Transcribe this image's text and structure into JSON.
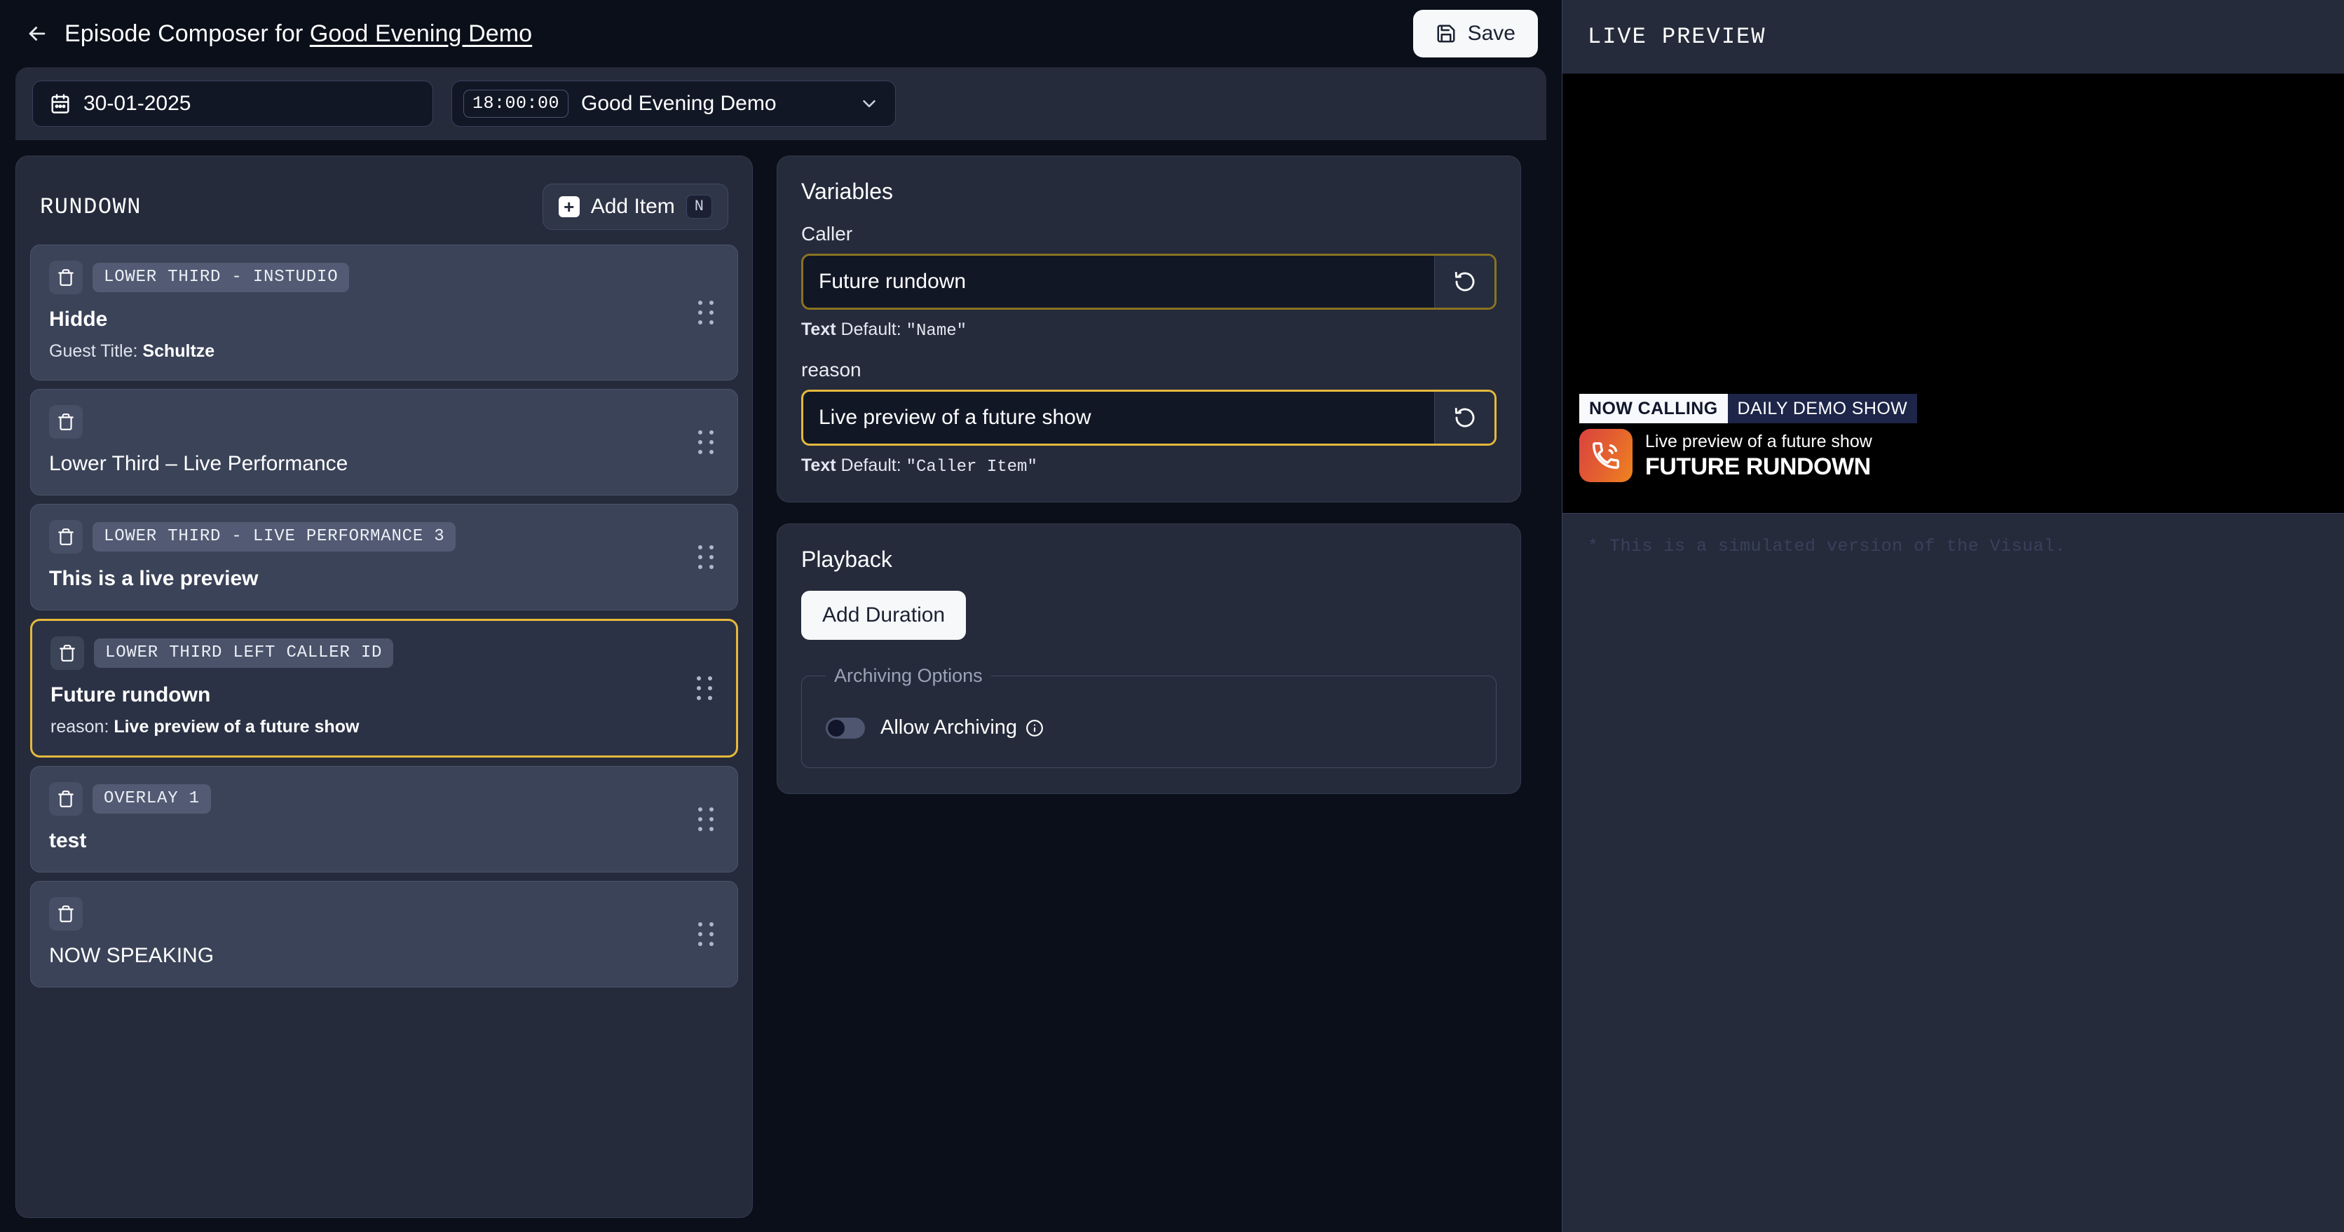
{
  "header": {
    "back_icon": "arrow-left-icon",
    "title_prefix": "Episode Composer for ",
    "show_name": "Good Evening Demo",
    "save_label": "Save",
    "save_icon": "floppy-disk-icon"
  },
  "strip": {
    "date_icon": "calendar-icon",
    "date_value": "30-01-2025",
    "episode_time": "18:00:00",
    "episode_name": "Good Evening Demo",
    "chevron_icon": "chevron-down-icon"
  },
  "rundown": {
    "title": "RUNDOWN",
    "add_item_label": "Add Item",
    "add_item_icon": "plus-square-icon",
    "add_item_shortcut": "N",
    "items": [
      {
        "badge": "LOWER THIRD - INSTUDIO",
        "title": "Hidde",
        "title_bold": true,
        "sub_label": "Guest Title: ",
        "sub_value": "Schultze",
        "selected": false,
        "delete_icon": "trash-icon",
        "drag_icon": "drag-handle-icon"
      },
      {
        "badge": "",
        "title": "Lower Third – Live Performance",
        "title_bold": false,
        "sub_label": "",
        "sub_value": "",
        "selected": false,
        "delete_icon": "trash-icon",
        "drag_icon": "drag-handle-icon"
      },
      {
        "badge": "LOWER THIRD - LIVE PERFORMANCE 3",
        "title": "This is a live preview",
        "title_bold": true,
        "sub_label": "",
        "sub_value": "",
        "selected": false,
        "delete_icon": "trash-icon",
        "drag_icon": "drag-handle-icon"
      },
      {
        "badge": "LOWER THIRD LEFT CALLER ID",
        "title": "Future rundown",
        "title_bold": true,
        "sub_label": "reason: ",
        "sub_value": "Live preview of a future show",
        "selected": true,
        "delete_icon": "trash-icon",
        "drag_icon": "drag-handle-icon"
      },
      {
        "badge": "OVERLAY 1",
        "title": "test",
        "title_bold": true,
        "sub_label": "",
        "sub_value": "",
        "selected": false,
        "delete_icon": "trash-icon",
        "drag_icon": "drag-handle-icon"
      },
      {
        "badge": "",
        "title": "NOW SPEAKING",
        "title_bold": false,
        "sub_label": "",
        "sub_value": "",
        "selected": false,
        "delete_icon": "trash-icon",
        "drag_icon": "drag-handle-icon"
      }
    ]
  },
  "variables": {
    "title": "Variables",
    "reset_icon": "reset-circular-arrow-icon",
    "fields": [
      {
        "label": "Caller",
        "value": "Future rundown",
        "hint_type": "Text",
        "hint_text": " Default: ",
        "hint_default": "\"Name\"",
        "focused": false
      },
      {
        "label": "reason",
        "value": "Live preview of a future show",
        "hint_type": "Text",
        "hint_text": " Default: ",
        "hint_default": "\"Caller Item\"",
        "focused": true
      }
    ]
  },
  "playback": {
    "title": "Playback",
    "add_duration_label": "Add Duration",
    "archiving_legend": "Archiving Options",
    "allow_archiving_label": "Allow Archiving",
    "allow_archiving_on": false,
    "info_icon": "info-circle-icon"
  },
  "preview": {
    "title": "LIVE PREVIEW",
    "note": "* This is a simulated version of the Visual.",
    "caller_id": {
      "now_calling": "NOW CALLING",
      "show_name": "DAILY DEMO SHOW",
      "phone_icon": "phone-ringing-icon",
      "reason": "Live preview of a future show",
      "caller_name": "FUTURE RUNDOWN"
    }
  },
  "colors": {
    "page_bg": "#0b0f19",
    "panel_bg": "#252b3b",
    "item_bg": "#3b4358",
    "accent_gold": "#e5b93c",
    "accent_gold_dim": "#8a7321",
    "light_button": "#f7f8fa",
    "caller_gradient_start": "#d9423f",
    "caller_gradient_end": "#ef8320",
    "cid_navy": "#1d2548"
  }
}
